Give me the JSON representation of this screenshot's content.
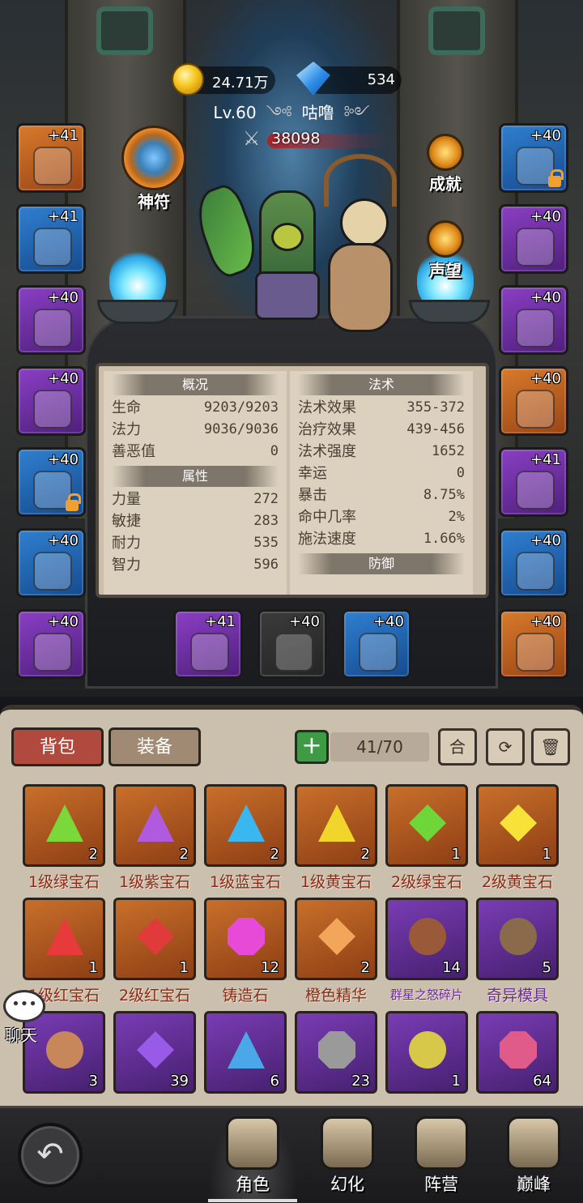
{
  "currency": {
    "gold": "24.71万",
    "diamond": "534"
  },
  "player": {
    "level": "Lv.60",
    "name": "咕噜",
    "power": "38098"
  },
  "badges": {
    "amulet": "神符",
    "achievement": "成就",
    "reputation": "声望"
  },
  "left_slots": [
    {
      "level": "+41",
      "rarity": "orange",
      "icon": "helmet-icon",
      "locked": false
    },
    {
      "level": "+41",
      "rarity": "blue",
      "icon": "necklace-icon",
      "locked": false
    },
    {
      "level": "+40",
      "rarity": "purple",
      "icon": "bracer-icon",
      "locked": false
    },
    {
      "level": "+40",
      "rarity": "purple",
      "icon": "shoulder-icon",
      "locked": false
    },
    {
      "level": "+40",
      "rarity": "blue",
      "icon": "horn-icon",
      "locked": true
    },
    {
      "level": "+40",
      "rarity": "blue",
      "icon": "glove-icon",
      "locked": false
    },
    {
      "level": "+40",
      "rarity": "purple",
      "icon": "dagger-icon",
      "locked": false
    }
  ],
  "right_slots": [
    {
      "level": "+40",
      "rarity": "blue",
      "icon": "belt-icon",
      "locked": true
    },
    {
      "level": "+40",
      "rarity": "purple",
      "icon": "pants-icon",
      "locked": false
    },
    {
      "level": "+40",
      "rarity": "purple",
      "icon": "boots-icon",
      "locked": false
    },
    {
      "level": "+40",
      "rarity": "orange",
      "icon": "ring-icon",
      "locked": false
    },
    {
      "level": "+41",
      "rarity": "purple",
      "icon": "ring-icon",
      "locked": false
    },
    {
      "level": "+40",
      "rarity": "blue",
      "icon": "pendant-icon",
      "locked": false
    },
    {
      "level": "+40",
      "rarity": "orange",
      "icon": "amulet-chain-icon",
      "locked": false
    }
  ],
  "weapon_slots": [
    {
      "level": "+41",
      "rarity": "purple",
      "icon": "pickaxe-icon"
    },
    {
      "level": "+40",
      "rarity": "gray",
      "icon": "shield-icon"
    },
    {
      "level": "+40",
      "rarity": "blue",
      "icon": "staff-icon"
    }
  ],
  "stats": {
    "overview": {
      "title": "概况",
      "rows": [
        {
          "label": "生命",
          "value": "9203/9203"
        },
        {
          "label": "法力",
          "value": "9036/9036"
        },
        {
          "label": "善恶值",
          "value": "0"
        }
      ]
    },
    "attributes": {
      "title": "属性",
      "rows": [
        {
          "label": "力量",
          "value": "272"
        },
        {
          "label": "敏捷",
          "value": "283"
        },
        {
          "label": "耐力",
          "value": "535"
        },
        {
          "label": "智力",
          "value": "596"
        }
      ]
    },
    "magic": {
      "title": "法术",
      "rows": [
        {
          "label": "法术效果",
          "value": "355-372"
        },
        {
          "label": "治疗效果",
          "value": "439-456"
        },
        {
          "label": "法术强度",
          "value": "1652"
        },
        {
          "label": "幸运",
          "value": "0"
        },
        {
          "label": "暴击",
          "value": "8.75%"
        },
        {
          "label": "命中几率",
          "value": "2%"
        },
        {
          "label": "施法速度",
          "value": "1.66%"
        }
      ]
    },
    "defense": {
      "title": "防御"
    }
  },
  "inventory": {
    "tab_bag": "背包",
    "tab_equip": "装备",
    "capacity": "41/70",
    "merge_label": "合",
    "items": [
      {
        "name": "1级绿宝石",
        "count": "2",
        "rarity": "o",
        "shape": "tri",
        "color": "#7bd83a"
      },
      {
        "name": "1级紫宝石",
        "count": "2",
        "rarity": "o",
        "shape": "tri",
        "color": "#b05ae0"
      },
      {
        "name": "1级蓝宝石",
        "count": "2",
        "rarity": "o",
        "shape": "tri",
        "color": "#3ab6f0"
      },
      {
        "name": "1级黄宝石",
        "count": "2",
        "rarity": "o",
        "shape": "tri",
        "color": "#f2d52a"
      },
      {
        "name": "2级绿宝石",
        "count": "1",
        "rarity": "o",
        "shape": "dia",
        "color": "#6fd63a"
      },
      {
        "name": "2级黄宝石",
        "count": "1",
        "rarity": "o",
        "shape": "dia",
        "color": "#f7e23a"
      },
      {
        "name": "1级红宝石",
        "count": "1",
        "rarity": "o",
        "shape": "tri",
        "color": "#e83a3a"
      },
      {
        "name": "2级红宝石",
        "count": "1",
        "rarity": "o",
        "shape": "dia",
        "color": "#e03a3a"
      },
      {
        "name": "铸造石",
        "count": "12",
        "rarity": "o",
        "shape": "oct",
        "color": "#e84ad8"
      },
      {
        "name": "橙色精华",
        "count": "2",
        "rarity": "o",
        "shape": "dia",
        "color": "#f2a65a"
      },
      {
        "name": "群星之怒碎片",
        "count": "14",
        "rarity": "p",
        "shape": "circ",
        "color": "#9a5a3a"
      },
      {
        "name": "奇异模具",
        "count": "5",
        "rarity": "p",
        "shape": "circ",
        "color": "#8a6a4a"
      },
      {
        "name": "",
        "count": "3",
        "rarity": "p",
        "shape": "circ",
        "color": "#c8875a"
      },
      {
        "name": "",
        "count": "39",
        "rarity": "p",
        "shape": "dia",
        "color": "#9a5ae8"
      },
      {
        "name": "",
        "count": "6",
        "rarity": "p",
        "shape": "tri",
        "color": "#4aa8e8"
      },
      {
        "name": "",
        "count": "23",
        "rarity": "p",
        "shape": "oct",
        "color": "#9a9a9a"
      },
      {
        "name": "",
        "count": "1",
        "rarity": "p",
        "shape": "circ",
        "color": "#d8c84a"
      },
      {
        "name": "",
        "count": "64",
        "rarity": "p",
        "shape": "oct",
        "color": "#e05a8a"
      }
    ]
  },
  "chat": {
    "label": "聊天"
  },
  "nav": [
    {
      "label": "角色",
      "active": true
    },
    {
      "label": "幻化",
      "active": false
    },
    {
      "label": "阵营",
      "active": false
    },
    {
      "label": "巅峰",
      "active": false
    }
  ]
}
